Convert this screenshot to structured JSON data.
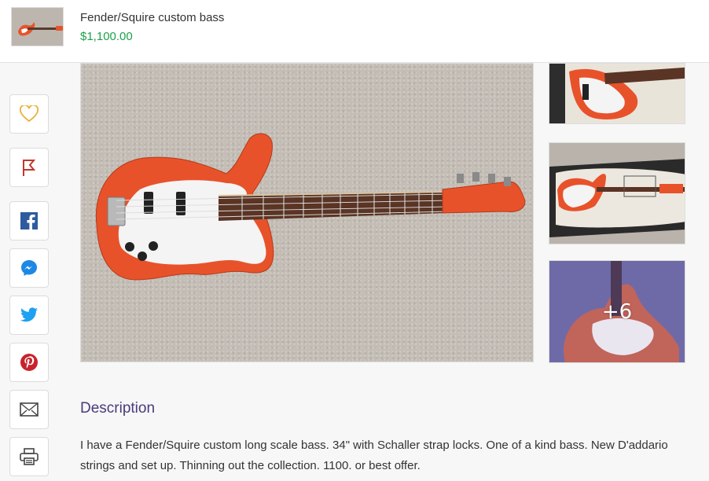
{
  "listing": {
    "title": "Fender/Squire custom bass",
    "price": "$1,100.00"
  },
  "share_actions": [
    {
      "name": "favorite",
      "icon": "heart-icon",
      "color": "#e9b13a"
    },
    {
      "name": "report",
      "icon": "flag-icon",
      "color": "#c0392b"
    },
    {
      "name": "facebook",
      "icon": "facebook-icon",
      "color": "#2d5b9e"
    },
    {
      "name": "messenger",
      "icon": "messenger-icon",
      "color": "#1e88e5"
    },
    {
      "name": "twitter",
      "icon": "twitter-icon",
      "color": "#1da1f2"
    },
    {
      "name": "pinterest",
      "icon": "pinterest-icon",
      "color": "#c8232c"
    },
    {
      "name": "email",
      "icon": "envelope-icon",
      "color": "#444444"
    },
    {
      "name": "print",
      "icon": "printer-icon",
      "color": "#444444"
    }
  ],
  "gallery": {
    "more_count": "+6"
  },
  "description": {
    "heading": "Description",
    "text": "I have a Fender/Squire custom long scale bass. 34\" with Schaller strap locks. One of a kind bass. New D'addario strings and set up. Thinning out the collection. 1100. or best offer."
  },
  "colors": {
    "price": "#1ea04a",
    "heading": "#4b3a7a",
    "guitar_body": "#e8522a"
  }
}
